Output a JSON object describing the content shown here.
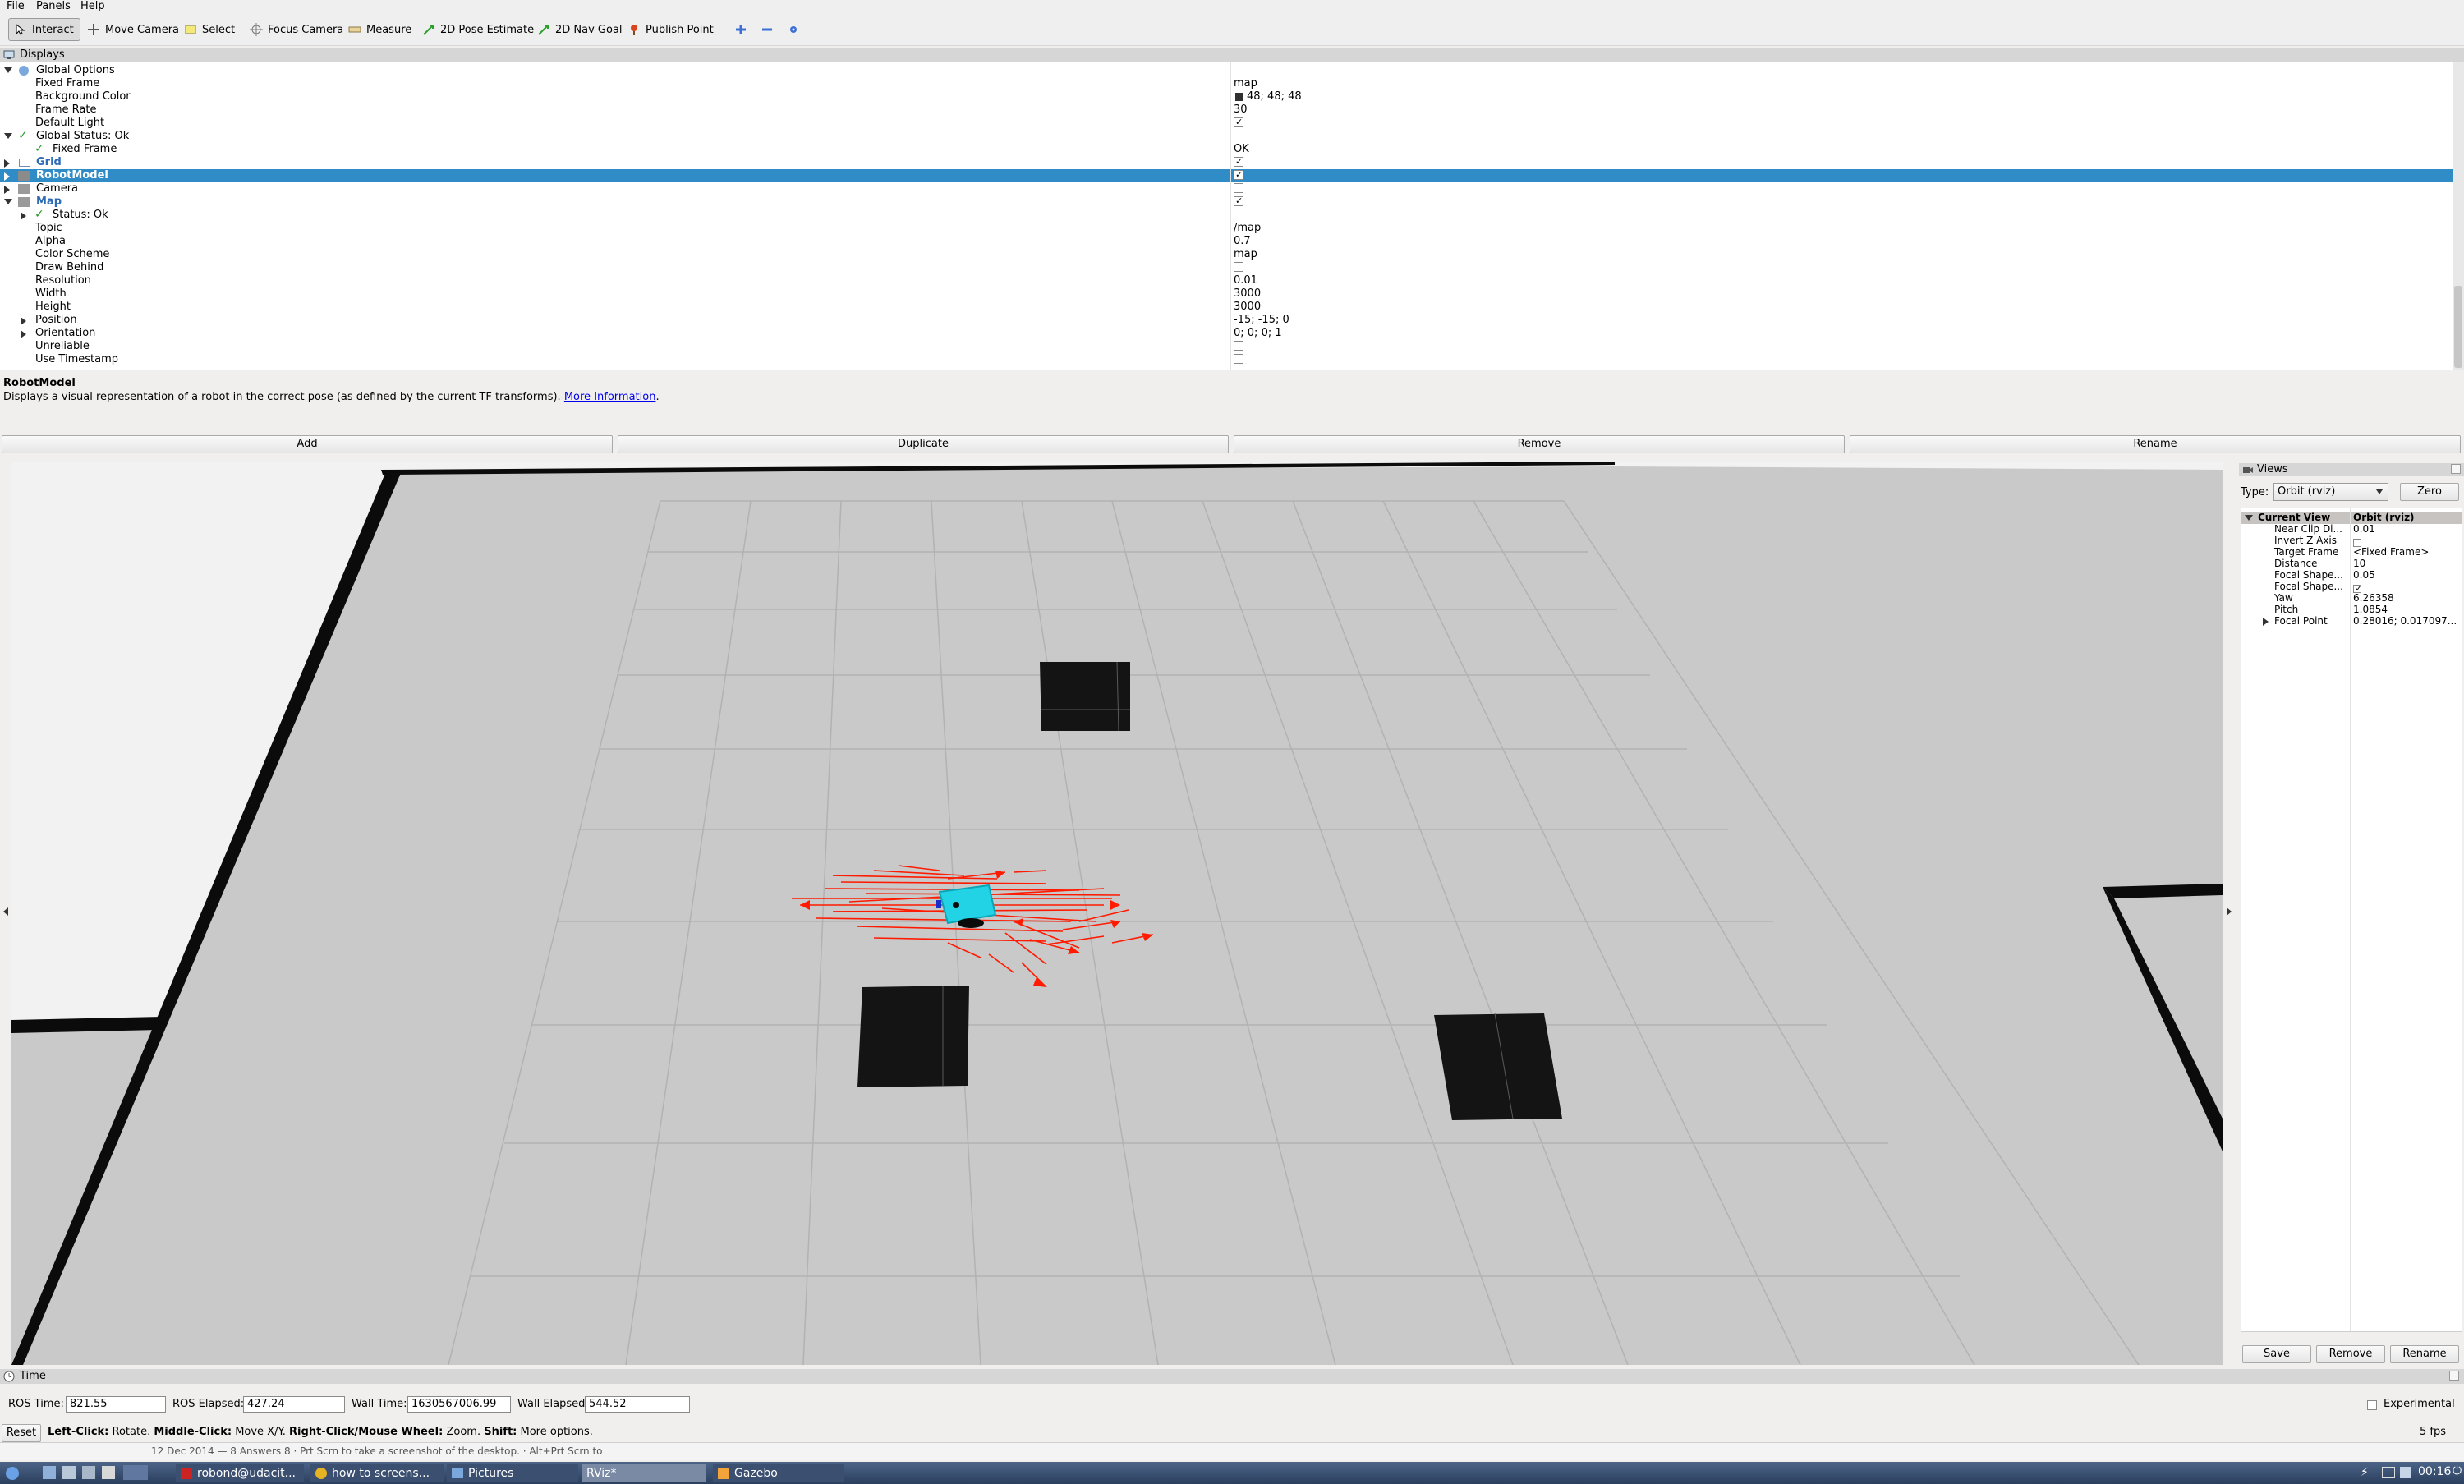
{
  "menubar": {
    "items": [
      "File",
      "Panels",
      "Help"
    ]
  },
  "toolbar": {
    "tools": [
      {
        "label": "Interact",
        "icon": "cursor-icon"
      },
      {
        "label": "Move Camera",
        "icon": "move-camera-icon"
      },
      {
        "label": "Select",
        "icon": "select-icon"
      },
      {
        "label": "Focus Camera",
        "icon": "focus-camera-icon"
      },
      {
        "label": "Measure",
        "icon": "ruler-icon"
      },
      {
        "label": "2D Pose Estimate",
        "icon": "green-arrow-icon"
      },
      {
        "label": "2D Nav Goal",
        "icon": "green-arrow-icon"
      },
      {
        "label": "Publish Point",
        "icon": "pin-icon"
      }
    ],
    "active": "Interact"
  },
  "displays": {
    "title": "Displays",
    "rows": [
      {
        "label": "Global Options",
        "value": ""
      },
      {
        "label": "Fixed Frame",
        "value": "map"
      },
      {
        "label": "Background Color",
        "value": "48; 48; 48"
      },
      {
        "label": "Frame Rate",
        "value": "30"
      },
      {
        "label": "Default Light",
        "value": ""
      },
      {
        "label": "Global Status: Ok",
        "value": ""
      },
      {
        "label": "Fixed Frame",
        "value": "OK"
      },
      {
        "label": "Grid",
        "value": ""
      },
      {
        "label": "RobotModel",
        "value": ""
      },
      {
        "label": "Camera",
        "value": ""
      },
      {
        "label": "Map",
        "value": ""
      },
      {
        "label": "Status: Ok",
        "value": ""
      },
      {
        "label": "Topic",
        "value": "/map"
      },
      {
        "label": "Alpha",
        "value": "0.7"
      },
      {
        "label": "Color Scheme",
        "value": "map"
      },
      {
        "label": "Draw Behind",
        "value": ""
      },
      {
        "label": "Resolution",
        "value": "0.01"
      },
      {
        "label": "Width",
        "value": "3000"
      },
      {
        "label": "Height",
        "value": "3000"
      },
      {
        "label": "Position",
        "value": "-15; -15; 0"
      },
      {
        "label": "Orientation",
        "value": "0; 0; 0; 1"
      },
      {
        "label": "Unreliable",
        "value": ""
      },
      {
        "label": "Use Timestamp",
        "value": ""
      }
    ]
  },
  "description": {
    "title": "RobotModel",
    "text": "Displays a visual representation of a robot in the correct pose (as defined by the current TF transforms).",
    "link": "More Information"
  },
  "display_buttons": [
    "Add",
    "Duplicate",
    "Remove",
    "Rename"
  ],
  "views": {
    "title": "Views",
    "type_label": "Type:",
    "type_value": "Orbit (rviz)",
    "zero_label": "Zero",
    "rows": [
      {
        "label": "Current View",
        "value": "Orbit (rviz)"
      },
      {
        "label": "Near Clip Di...",
        "value": "0.01"
      },
      {
        "label": "Invert Z Axis",
        "value": ""
      },
      {
        "label": "Target Frame",
        "value": "<Fixed Frame>"
      },
      {
        "label": "Distance",
        "value": "10"
      },
      {
        "label": "Focal Shape...",
        "value": "0.05"
      },
      {
        "label": "Focal Shape...",
        "value": ""
      },
      {
        "label": "Yaw",
        "value": "6.26358"
      },
      {
        "label": "Pitch",
        "value": "1.0854"
      },
      {
        "label": "Focal Point",
        "value": "0.28016; 0.017097..."
      }
    ],
    "buttons": [
      "Save",
      "Remove",
      "Rename"
    ]
  },
  "time": {
    "title": "Time",
    "ros_time_label": "ROS Time:",
    "ros_time": "821.55",
    "ros_elapsed_label": "ROS Elapsed:",
    "ros_elapsed": "427.24",
    "wall_time_label": "Wall Time:",
    "wall_time": "1630567006.99",
    "wall_elapsed_label": "Wall Elapsed:",
    "wall_elapsed": "544.52",
    "experimental": "Experimental"
  },
  "help": {
    "reset": "Reset",
    "left": "Left-Click:",
    "left_t": "Rotate.",
    "middle": "Middle-Click:",
    "middle_t": "Move X/Y.",
    "right": "Right-Click/Mouse Wheel:",
    "right_t": "Zoom.",
    "shift": "Shift:",
    "shift_t": "More options.",
    "fps": "5 fps"
  },
  "statusline": "12 Dec 2014 — 8 Answers 8 · Prt Scrn to take a screenshot of the desktop. · Alt+Prt Scrn to",
  "taskbar": {
    "tasks": [
      "robond@udacit...",
      "how to screens...",
      "Pictures",
      "RViz*",
      "Gazebo"
    ],
    "clock": "00:16"
  },
  "colors": {
    "selection": "#308cc6",
    "robot": "#22d3e6",
    "particles": "#ff1a00"
  }
}
